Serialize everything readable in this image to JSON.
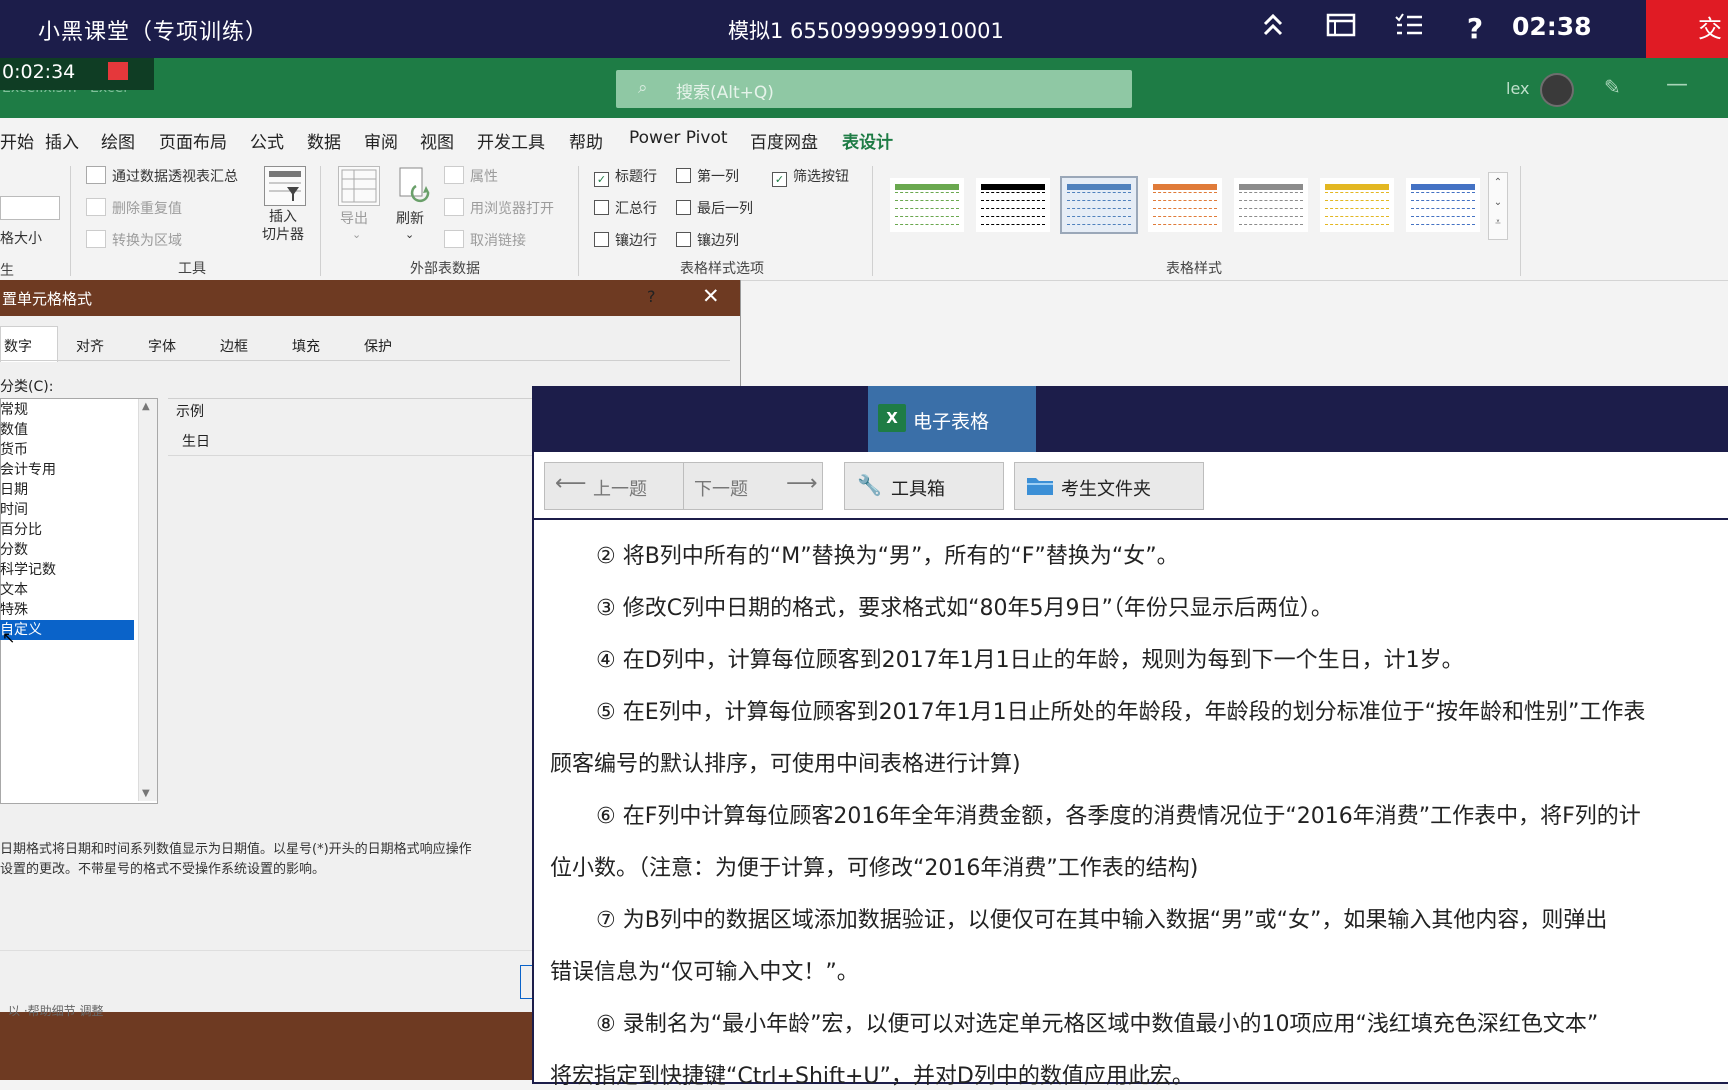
{
  "exam_bar": {
    "title": "小黑课堂（专项训练）",
    "center": "模拟1   6550999999910001",
    "timer": "02:38",
    "submit": "交",
    "icons": [
      "collapse-up-icon",
      "window-icon",
      "list-icon",
      "help-icon"
    ]
  },
  "recording": {
    "elapsed": "0:02:34"
  },
  "excel": {
    "file_name": "Excel.xlsm  ·  Excel",
    "search_placeholder": "搜索(Alt+Q)",
    "user": "lex"
  },
  "ribbon_tabs": [
    "开始",
    "插入",
    "绘图",
    "页面布局",
    "公式",
    "数据",
    "审阅",
    "视图",
    "开发工具",
    "帮助",
    "Power Pivot",
    "百度网盘",
    "表设计"
  ],
  "active_tab": "表设计",
  "ribbon": {
    "size_label": "格大小",
    "props_label": "生",
    "tools": {
      "summarize": "通过数据透视表汇总",
      "remove_dupes": "删除重复值",
      "convert_range": "转换为区域",
      "insert_slicer": "插入\n切片器",
      "group": "工具"
    },
    "external": {
      "export": "导出",
      "refresh": "刷新",
      "properties": "属性",
      "open_browser": "用浏览器打开",
      "unlink": "取消链接",
      "group": "外部表数据"
    },
    "style_options": {
      "header_row": "标题行",
      "first_col": "第一列",
      "filter_btn": "筛选按钮",
      "total_row": "汇总行",
      "last_col": "最后一列",
      "banded_rows": "镶边行",
      "banded_cols": "镶边列",
      "group": "表格样式选项",
      "checked": {
        "header_row": true,
        "first_col": false,
        "filter_btn": true,
        "total_row": false,
        "last_col": false,
        "banded_rows": false,
        "banded_cols": false
      }
    },
    "table_styles": {
      "group": "表格样式",
      "colors": [
        "#6aa84f",
        "#000000",
        "#4f81bd",
        "#e07b39",
        "#8c8c8c",
        "#e3b721",
        "#4472c4"
      ]
    }
  },
  "dialog": {
    "title": "置单元格格式",
    "help": "?",
    "close": "✕",
    "tabs": [
      "数字",
      "对齐",
      "字体",
      "边框",
      "填充",
      "保护"
    ],
    "category_label": "分类(C):",
    "categories": [
      "常规",
      "数值",
      "货币",
      "会计专用",
      "日期",
      "时间",
      "百分比",
      "分数",
      "科学记数",
      "文本",
      "特殊",
      "自定义"
    ],
    "selected_category": "自定义",
    "sample_label": "示例",
    "sample_value": "生日",
    "description_line1": "日期格式将日期和时间系列数值显示为日期值。以星号(*)开头的日期格式响应操作",
    "description_line2": "设置的更改。不带星号的格式不受操作系统设置的影响。",
    "bottom_text": "以 ·帮助细节 调整"
  },
  "panel": {
    "tab_label": "电子表格",
    "prev": "上一题",
    "next": "下一题",
    "toolbox": "工具箱",
    "folder": "考生文件夹",
    "questions": [
      "② 将B列中所有的“M”替换为“男”，所有的“F”替换为“女”。",
      "③ 修改C列中日期的格式，要求格式如“80年5月9日”（年份只显示后两位）。",
      "④ 在D列中，计算每位顾客到2017年1月1日止的年龄，规则为每到下一个生日，计1岁。",
      "⑤ 在E列中，计算每位顾客到2017年1月1日止所处的年龄段，年龄段的划分标准位于“按年龄和性别”工作表",
      "顾客编号的默认排序，可使用中间表格进行计算)",
      "⑥ 在F列中计算每位顾客2016年全年消费金额，各季度的消费情况位于“2016年消费”工作表中，将F列的计",
      "位小数。（注意：为便于计算，可修改“2016年消费”工作表的结构)",
      "⑦ 为B列中的数据区域添加数据验证，以便仅可在其中输入数据“男”或“女”，如果输入其他内容，则弹出",
      "错误信息为“仅可输入中文！”。",
      "⑧ 录制名为“最小年龄”宏，以便可以对选定单元格区域中数值最小的10项应用“浅红填充色深红色文本”",
      "将宏指定到快捷键“Ctrl+Shift+U”，并对D列中的数值应用此宏。"
    ]
  }
}
